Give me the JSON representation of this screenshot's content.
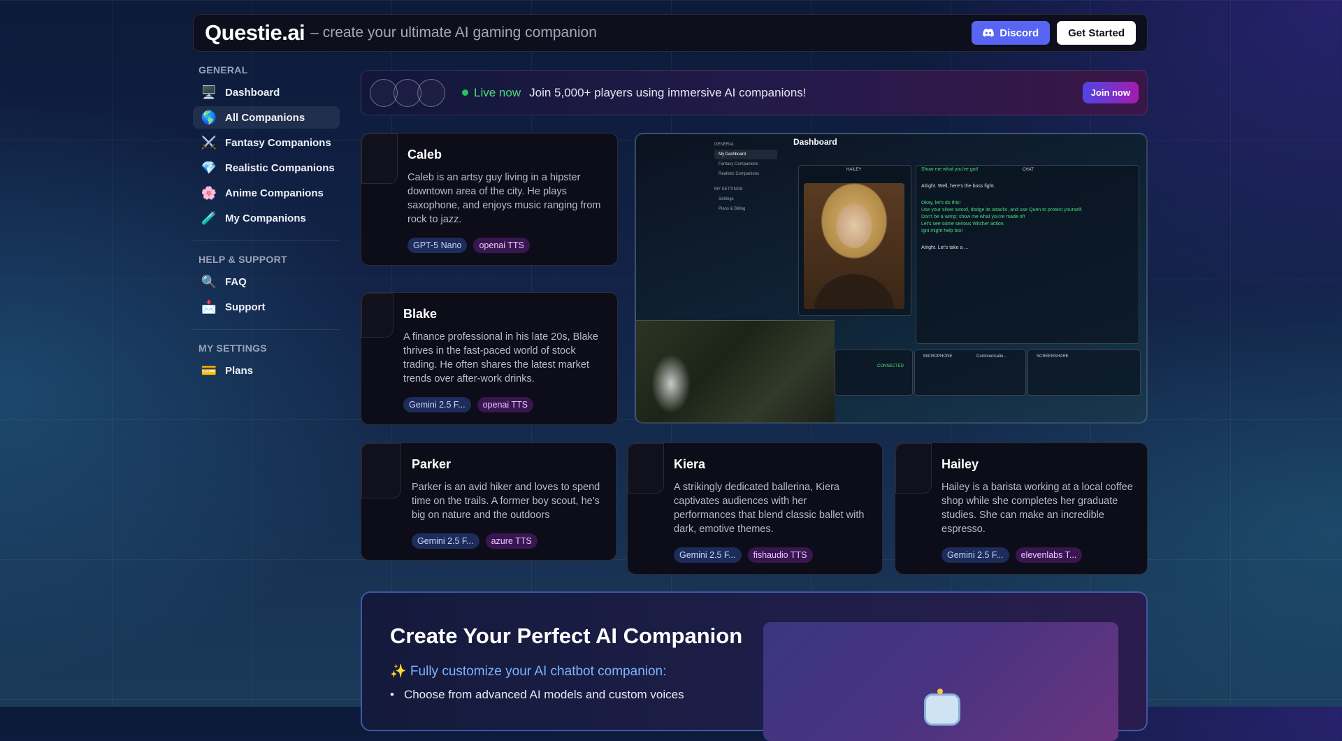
{
  "header": {
    "brand": "Questie.ai",
    "tagline": "– create your ultimate AI gaming companion",
    "discord_label": "Discord",
    "get_started_label": "Get Started"
  },
  "sidebar": {
    "general_title": "GENERAL",
    "general_items": [
      {
        "label": "Dashboard",
        "icon": "🖥️"
      },
      {
        "label": "All Companions",
        "icon": "🌎"
      },
      {
        "label": "Fantasy Companions",
        "icon": "⚔️"
      },
      {
        "label": "Realistic Companions",
        "icon": "💎"
      },
      {
        "label": "Anime Companions",
        "icon": "🌸"
      },
      {
        "label": "My Companions",
        "icon": "🧪"
      }
    ],
    "help_title": "HELP & SUPPORT",
    "help_items": [
      {
        "label": "FAQ",
        "icon": "🔍"
      },
      {
        "label": "Support",
        "icon": "📩"
      }
    ],
    "settings_title": "MY SETTINGS",
    "settings_items": [
      {
        "label": "Plans",
        "icon": "💳"
      }
    ]
  },
  "banner": {
    "live_label": "Live now",
    "message": "Join 5,000+ players using immersive AI companions!",
    "join_label": "Join now"
  },
  "companions": [
    {
      "name": "Caleb",
      "description": "Caleb is an artsy guy living in a hipster downtown area of the city. He plays saxophone, and enjoys music ranging from rock to jazz.",
      "model": "GPT-5 Nano",
      "tts": "openai TTS"
    },
    {
      "name": "Blake",
      "description": "A finance professional in his late 20s, Blake thrives in the fast-paced world of stock trading. He often shares the latest market trends over after-work drinks.",
      "model": "Gemini 2.5 F...",
      "tts": "openai TTS"
    },
    {
      "name": "Parker",
      "description": "Parker is an avid hiker and loves to spend time on the trails. A former boy scout, he's big on nature and the outdoors",
      "model": "Gemini 2.5 F...",
      "tts": "azure TTS"
    },
    {
      "name": "Kiera",
      "description": "A strikingly dedicated ballerina, Kiera captivates audiences with her performances that blend classic ballet with dark, emotive themes.",
      "model": "Gemini 2.5 F...",
      "tts": "fishaudio TTS"
    },
    {
      "name": "Hailey",
      "description": "Hailey is a barista working at a local coffee shop while she completes her graduate studies. She can make an incredible espresso.",
      "model": "Gemini 2.5 F...",
      "tts": "elevenlabs T..."
    }
  ],
  "preview": {
    "title": "Dashboard",
    "side_general": "GENERAL",
    "side_items": [
      "My Dashboard",
      "Fantasy Companions",
      "Realistic Companions"
    ],
    "side_settings": "MY SETTINGS",
    "side_settings_items": [
      "Settings",
      "Plans & Billing"
    ],
    "hailey_label": "HAILEY",
    "chat_label": "CHAT",
    "chat_lines": [
      {
        "style": "g",
        "text": "Show me what you've got!"
      },
      {
        "style": "w",
        "text": "Alright. Well, here's the boss fight."
      },
      {
        "style": "g",
        "text": "Okay, let's do this!"
      },
      {
        "style": "g",
        "text": "Use your silver sword, dodge its attacks, and use Quen to protect yourself."
      },
      {
        "style": "g",
        "text": "Don't be a wimp; show me what you're made of!"
      },
      {
        "style": "g",
        "text": "Let's see some serious Witcher action."
      },
      {
        "style": "g",
        "text": "Igni might help too!"
      },
      {
        "style": "w",
        "text": "Alright. Let's take a ..."
      }
    ],
    "microphone_label": "MICROPHONE",
    "screenshare_label": "SCREENSHARE",
    "connected_label": "CONNECTED",
    "mic_device": "Communicatio..."
  },
  "create": {
    "title": "Create Your Perfect AI Companion",
    "subtitle": "✨ Fully customize your AI chatbot companion:",
    "bullet": "Choose from advanced AI models and custom voices"
  }
}
